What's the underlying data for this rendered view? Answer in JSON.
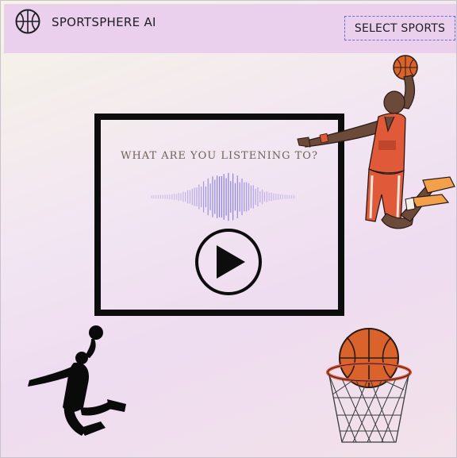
{
  "header": {
    "brand": "SPORTSPHERE AI",
    "logo_icon": "basketball-icon",
    "select_label": "SELECT SPORTS"
  },
  "card": {
    "question": "WHAT ARE YOU LISTENING TO?",
    "wave_icon": "sound-wave-icon",
    "play_icon": "play-button-icon"
  },
  "illustrations": [
    "dunking-player",
    "jumping-player-silhouette",
    "basketball-hoop"
  ],
  "colors": {
    "header_bg": "#ebd0ee",
    "accent_border": "#6b6bd6",
    "card_border": "#0d0d0d",
    "wave": "#8a7fe0",
    "jersey": "#e05a3a",
    "ball": "#d9632a"
  }
}
